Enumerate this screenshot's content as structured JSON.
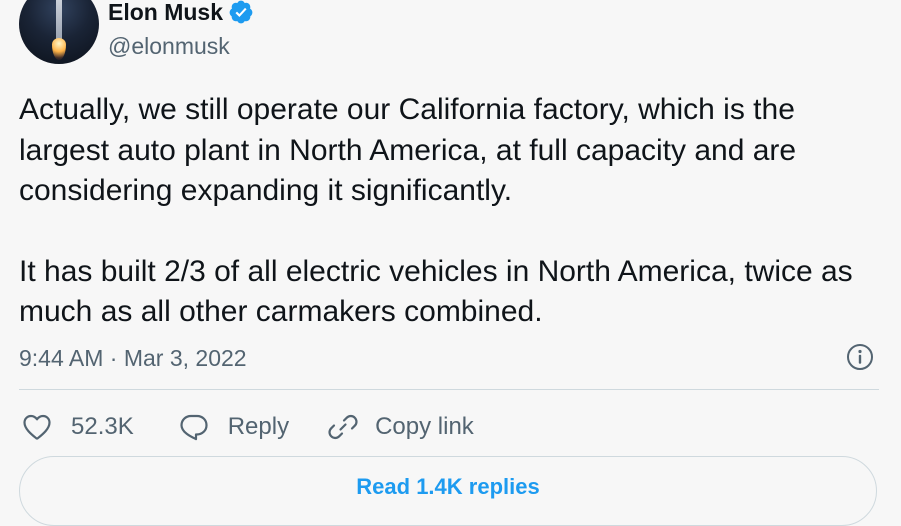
{
  "author": {
    "name": "Elon Musk",
    "handle": "@elonmusk",
    "verified_icon": "verified-badge-icon"
  },
  "tweet": {
    "paragraphs": [
      "Actually, we still operate our California factory, which is the largest auto plant in North America, at full capacity and are considering expanding it significantly.",
      "It has built 2/3 of all electric vehicles in North America, twice as much as all other carmakers combined."
    ],
    "timestamp": "9:44 AM · Mar 3, 2022"
  },
  "actions": {
    "like_count": "52.3K",
    "reply_label": "Reply",
    "copy_link_label": "Copy link"
  },
  "read_replies_label": "Read 1.4K replies",
  "colors": {
    "accent": "#1d9bf0",
    "text_primary": "#0f1419",
    "text_secondary": "#536471",
    "divider": "#cfd9de",
    "background": "#f7f7f7"
  }
}
